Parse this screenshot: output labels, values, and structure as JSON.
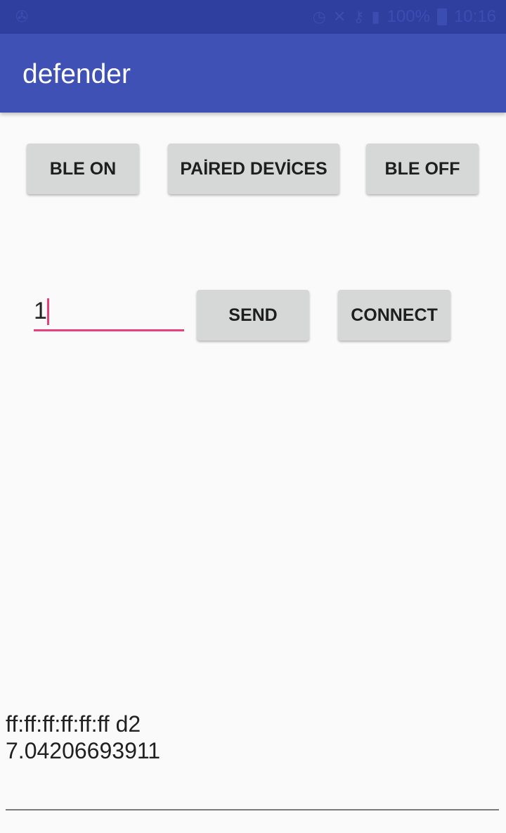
{
  "status_bar": {
    "left_icon": "notification-icon",
    "battery_percent": "100%",
    "time": "10:16",
    "icons": [
      "alarm-icon",
      "mute-icon",
      "vpn-key-icon",
      "signal-icon",
      "battery-icon"
    ]
  },
  "app_bar": {
    "title": "defender"
  },
  "buttons": {
    "ble_on": "BLE ON",
    "paired_devices": "PAİRED DEVİCES",
    "ble_off": "BLE OFF",
    "send": "SEND",
    "connect": "CONNECT"
  },
  "message_input": {
    "value": "1"
  },
  "device_info": {
    "line1": "ff:ff:ff:ff:ff:ff d2",
    "line2": "7.04206693911"
  },
  "colors": {
    "status_bar": "#2f3f9f",
    "app_bar": "#3f51b5",
    "accent": "#e8407a",
    "button": "#d6d7d7",
    "background": "#fafafa"
  }
}
